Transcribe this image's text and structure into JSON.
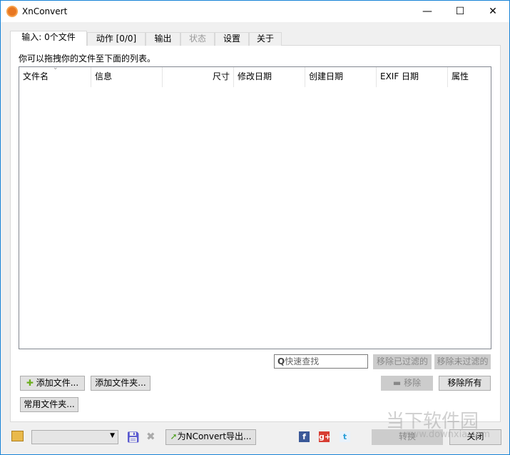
{
  "window": {
    "title": "XnConvert",
    "minimize": "—",
    "maximize": "☐",
    "close": "✕"
  },
  "tabs": [
    {
      "label": "输入:  0个文件"
    },
    {
      "label": "动作 [0/0]"
    },
    {
      "label": "输出"
    },
    {
      "label": "状态"
    },
    {
      "label": "设置"
    },
    {
      "label": "关于"
    }
  ],
  "input": {
    "hint": "你可以拖拽你的文件至下面的列表。",
    "columns": [
      "文件名",
      "信息",
      "尺寸",
      "修改日期",
      "创建日期",
      "EXIF 日期",
      "属性"
    ],
    "search_placeholder": "快速查找",
    "remove_filtered": "移除已过滤的",
    "remove_unfiltered": "移除未过滤的",
    "add_files": "添加文件...",
    "add_folder": "添加文件夹...",
    "remove": "移除",
    "remove_all": "移除所有",
    "common_folders": "常用文件夹..."
  },
  "bottom": {
    "export": "为NConvert导出...",
    "convert": "转换",
    "close": "关闭"
  },
  "watermark": {
    "name": "当下软件园",
    "url": "www.downxia.com"
  }
}
